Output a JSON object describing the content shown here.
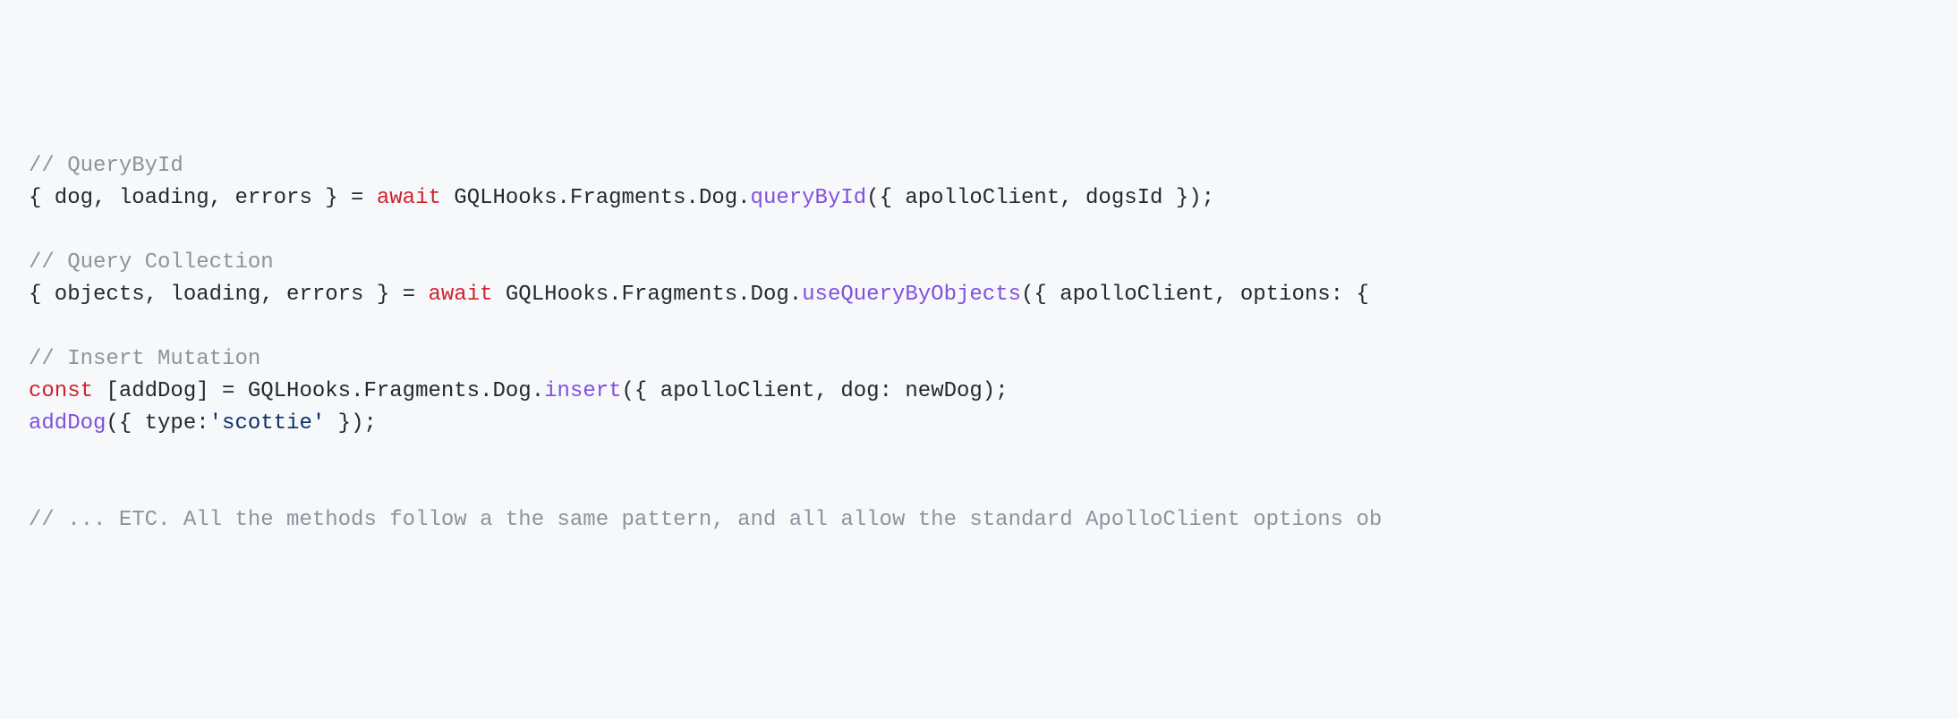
{
  "code": {
    "lines": [
      {
        "tokens": [
          {
            "text": "// QueryById",
            "cls": "tok-comment"
          }
        ]
      },
      {
        "tokens": [
          {
            "text": "{ dog, loading, errors } = ",
            "cls": "tok-plain"
          },
          {
            "text": "await",
            "cls": "tok-keyword"
          },
          {
            "text": " GQLHooks.Fragments.Dog.",
            "cls": "tok-plain"
          },
          {
            "text": "queryById",
            "cls": "tok-method"
          },
          {
            "text": "({ apolloClient, dogsId });",
            "cls": "tok-plain"
          }
        ]
      },
      {
        "tokens": []
      },
      {
        "tokens": [
          {
            "text": "// Query Collection",
            "cls": "tok-comment"
          }
        ]
      },
      {
        "tokens": [
          {
            "text": "{ objects, loading, errors } = ",
            "cls": "tok-plain"
          },
          {
            "text": "await",
            "cls": "tok-keyword"
          },
          {
            "text": " GQLHooks.Fragments.Dog.",
            "cls": "tok-plain"
          },
          {
            "text": "useQueryByObjects",
            "cls": "tok-method"
          },
          {
            "text": "({ apolloClient, options: { ",
            "cls": "tok-plain"
          }
        ]
      },
      {
        "tokens": []
      },
      {
        "tokens": [
          {
            "text": "// Insert Mutation",
            "cls": "tok-comment"
          }
        ]
      },
      {
        "tokens": [
          {
            "text": "const",
            "cls": "tok-keyword"
          },
          {
            "text": " [addDog] = GQLHooks.Fragments.Dog.",
            "cls": "tok-plain"
          },
          {
            "text": "insert",
            "cls": "tok-method"
          },
          {
            "text": "({ apolloClient, dog: newDog);",
            "cls": "tok-plain"
          }
        ]
      },
      {
        "tokens": [
          {
            "text": "addDog",
            "cls": "tok-call"
          },
          {
            "text": "({ type:",
            "cls": "tok-plain"
          },
          {
            "text": "'scottie'",
            "cls": "tok-string"
          },
          {
            "text": " });",
            "cls": "tok-plain"
          }
        ]
      },
      {
        "tokens": []
      },
      {
        "tokens": []
      },
      {
        "tokens": [
          {
            "text": "// ... ETC. All the methods follow a the same pattern, and all allow the standard ApolloClient options ob",
            "cls": "tok-comment"
          }
        ]
      }
    ]
  }
}
